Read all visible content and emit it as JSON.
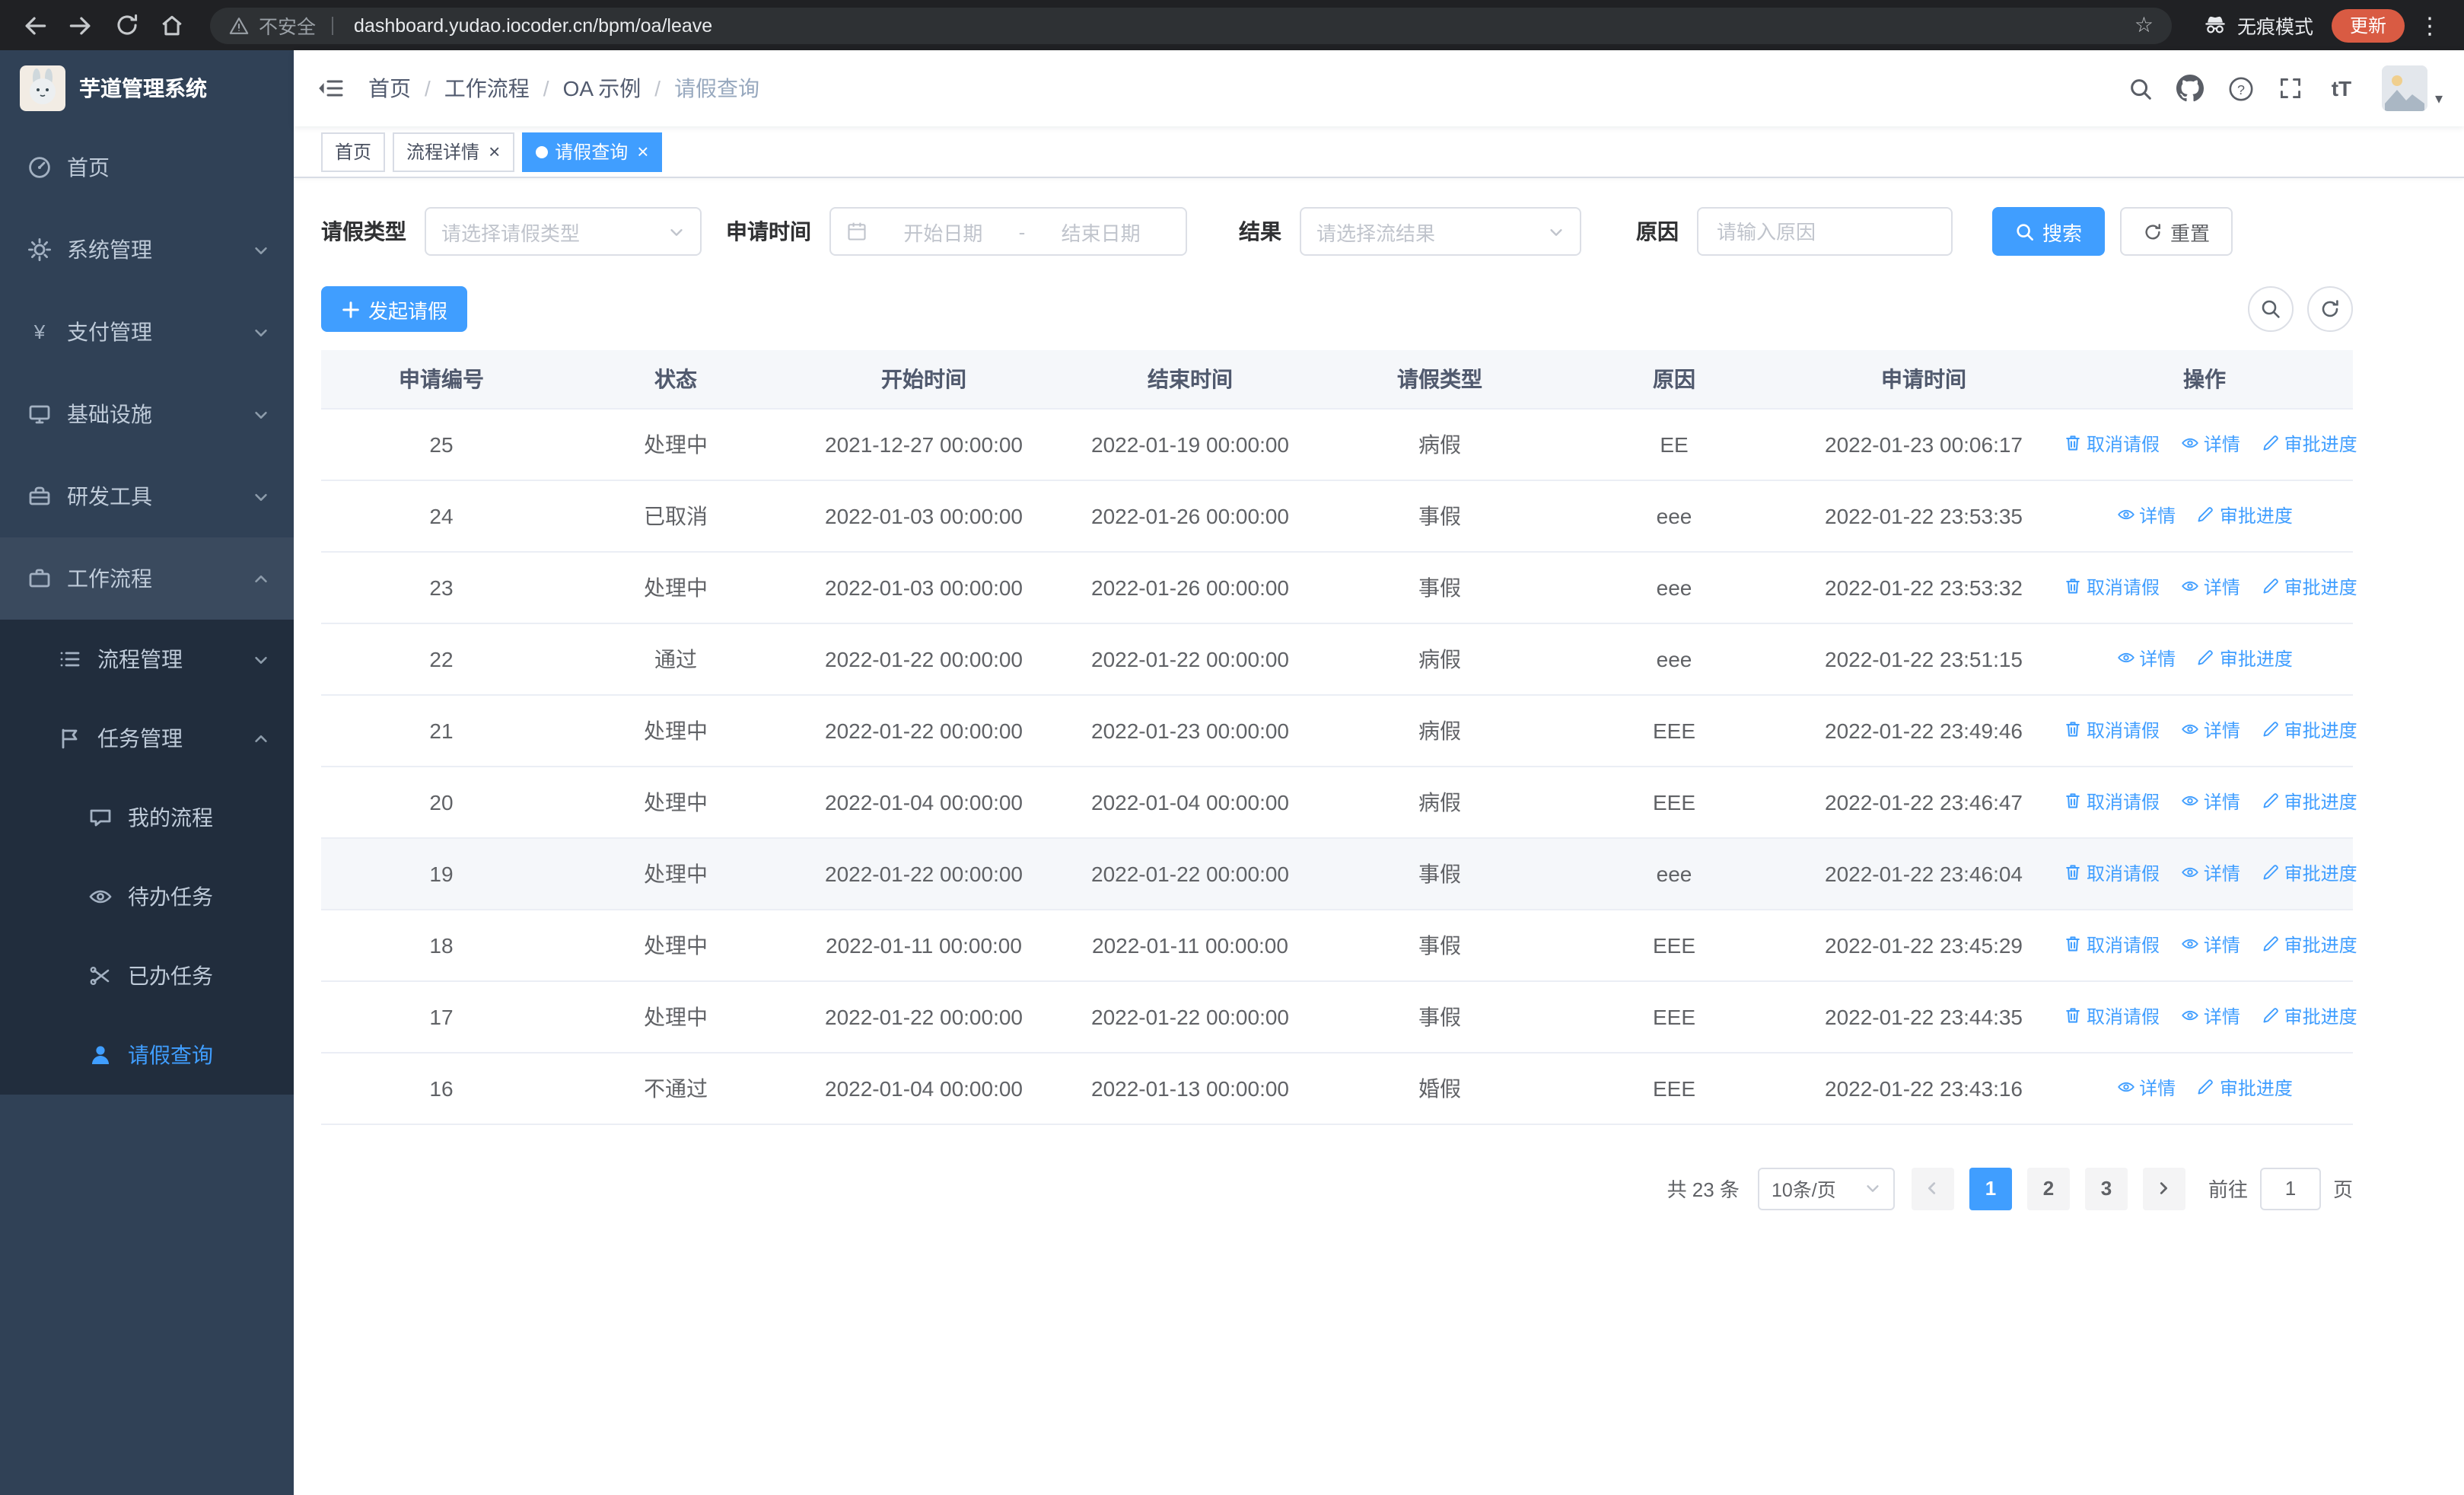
{
  "colors": {
    "primary": "#409eff",
    "sidebar_bg": "#304156",
    "sidebar_submenu_bg": "#212d3d",
    "sidebar_text": "#bfcbd9",
    "chrome_bg": "#202124",
    "update_badge": "#d95b43"
  },
  "icons": {
    "star-glyph": "☆",
    "kebab-glyph": "⋮",
    "caret-down-glyph": "▾"
  },
  "browser": {
    "security_label": "不安全",
    "url": "dashboard.yudao.iocoder.cn/bpm/oa/leave",
    "incognito_label": "无痕模式",
    "update_label": "更新"
  },
  "sidebar": {
    "title": "芋道管理系统",
    "items": [
      {
        "label": "首页",
        "icon": "dashboard-icon",
        "level": 1
      },
      {
        "label": "系统管理",
        "icon": "gear-icon",
        "level": 1,
        "chevron": "down"
      },
      {
        "label": "支付管理",
        "icon": "yen-icon",
        "level": 1,
        "chevron": "down"
      },
      {
        "label": "基础设施",
        "icon": "infrastructure-icon",
        "level": 1,
        "chevron": "down"
      },
      {
        "label": "研发工具",
        "icon": "toolbox-icon",
        "level": 1,
        "chevron": "down"
      },
      {
        "label": "工作流程",
        "icon": "briefcase-icon",
        "level": 1,
        "chevron": "up",
        "expanded": true
      },
      {
        "label": "流程管理",
        "icon": "list-icon",
        "level": 2,
        "chevron": "down"
      },
      {
        "label": "任务管理",
        "icon": "flag-icon",
        "level": 2,
        "chevron": "up",
        "expanded": true
      },
      {
        "label": "我的流程",
        "icon": "chat-bubble-icon",
        "level": 3
      },
      {
        "label": "待办任务",
        "icon": "eye-icon",
        "level": 3
      },
      {
        "label": "已办任务",
        "icon": "scissors-icon",
        "level": 3
      },
      {
        "label": "请假查询",
        "icon": "person-icon",
        "level": 3,
        "active": true
      }
    ]
  },
  "header": {
    "breadcrumbs": [
      "首页",
      "工作流程",
      "OA 示例",
      "请假查询"
    ],
    "breadcrumb_separator": "/",
    "font_size_glyph": "tT"
  },
  "tags_view": {
    "close_glyph": "×",
    "tabs": [
      {
        "label": "首页",
        "closable": false,
        "active": false
      },
      {
        "label": "流程详情",
        "closable": true,
        "active": false
      },
      {
        "label": "请假查询",
        "closable": true,
        "active": true
      }
    ]
  },
  "filters": {
    "leave_type_label": "请假类型",
    "leave_type_placeholder": "请选择请假类型",
    "apply_time_label": "申请时间",
    "start_date_placeholder": "开始日期",
    "range_separator": "-",
    "end_date_placeholder": "结束日期",
    "result_label": "结果",
    "result_placeholder": "请选择流结果",
    "reason_label": "原因",
    "reason_placeholder": "请输入原因",
    "search_label": "搜索",
    "reset_label": "重置"
  },
  "toolbar": {
    "create_label": "发起请假"
  },
  "table": {
    "columns": [
      "申请编号",
      "状态",
      "开始时间",
      "结束时间",
      "请假类型",
      "原因",
      "申请时间",
      "操作"
    ],
    "actions": {
      "cancel": "取消请假",
      "detail": "详情",
      "progress": "审批进度"
    },
    "rows": [
      {
        "id": "25",
        "status": "处理中",
        "start": "2021-12-27 00:00:00",
        "end": "2022-01-19 00:00:00",
        "type": "病假",
        "reason": "EE",
        "applied": "2022-01-23 00:06:17",
        "can_cancel": true,
        "highlight": false
      },
      {
        "id": "24",
        "status": "已取消",
        "start": "2022-01-03 00:00:00",
        "end": "2022-01-26 00:00:00",
        "type": "事假",
        "reason": "eee",
        "applied": "2022-01-22 23:53:35",
        "can_cancel": false,
        "highlight": false
      },
      {
        "id": "23",
        "status": "处理中",
        "start": "2022-01-03 00:00:00",
        "end": "2022-01-26 00:00:00",
        "type": "事假",
        "reason": "eee",
        "applied": "2022-01-22 23:53:32",
        "can_cancel": true,
        "highlight": false
      },
      {
        "id": "22",
        "status": "通过",
        "start": "2022-01-22 00:00:00",
        "end": "2022-01-22 00:00:00",
        "type": "病假",
        "reason": "eee",
        "applied": "2022-01-22 23:51:15",
        "can_cancel": false,
        "highlight": false
      },
      {
        "id": "21",
        "status": "处理中",
        "start": "2022-01-22 00:00:00",
        "end": "2022-01-23 00:00:00",
        "type": "病假",
        "reason": "EEE",
        "applied": "2022-01-22 23:49:46",
        "can_cancel": true,
        "highlight": false
      },
      {
        "id": "20",
        "status": "处理中",
        "start": "2022-01-04 00:00:00",
        "end": "2022-01-04 00:00:00",
        "type": "病假",
        "reason": "EEE",
        "applied": "2022-01-22 23:46:47",
        "can_cancel": true,
        "highlight": false
      },
      {
        "id": "19",
        "status": "处理中",
        "start": "2022-01-22 00:00:00",
        "end": "2022-01-22 00:00:00",
        "type": "事假",
        "reason": "eee",
        "applied": "2022-01-22 23:46:04",
        "can_cancel": true,
        "highlight": true
      },
      {
        "id": "18",
        "status": "处理中",
        "start": "2022-01-11 00:00:00",
        "end": "2022-01-11 00:00:00",
        "type": "事假",
        "reason": "EEE",
        "applied": "2022-01-22 23:45:29",
        "can_cancel": true,
        "highlight": false
      },
      {
        "id": "17",
        "status": "处理中",
        "start": "2022-01-22 00:00:00",
        "end": "2022-01-22 00:00:00",
        "type": "事假",
        "reason": "EEE",
        "applied": "2022-01-22 23:44:35",
        "can_cancel": true,
        "highlight": false
      },
      {
        "id": "16",
        "status": "不通过",
        "start": "2022-01-04 00:00:00",
        "end": "2022-01-13 00:00:00",
        "type": "婚假",
        "reason": "EEE",
        "applied": "2022-01-22 23:43:16",
        "can_cancel": false,
        "highlight": false
      }
    ]
  },
  "pagination": {
    "total_label": "共 23 条",
    "page_size_label": "10条/页",
    "pages": [
      "1",
      "2",
      "3"
    ],
    "active_page": "1",
    "goto_label": "前往",
    "goto_value": "1",
    "goto_suffix": "页"
  }
}
